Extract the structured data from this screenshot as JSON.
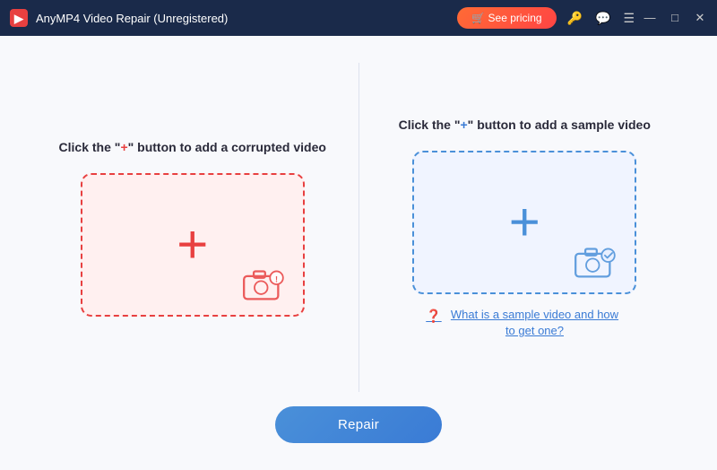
{
  "titleBar": {
    "logo": "◈",
    "title": "AnyMP4 Video Repair (Unregistered)",
    "pricingLabel": "🛒 See pricing",
    "icons": [
      "🔑",
      "💬",
      "☰"
    ],
    "winControls": [
      "—",
      "□",
      "✕"
    ]
  },
  "panels": {
    "left": {
      "instruction": "Click the \"+\" button to add a corrupted video",
      "plusColor": "red",
      "boxType": "red"
    },
    "right": {
      "instruction": "Click the \"+\" button to add a sample video",
      "plusColor": "blue",
      "boxType": "blue",
      "helpText": "What is a sample video and how to get one?"
    }
  },
  "repairButton": {
    "label": "Repair"
  }
}
